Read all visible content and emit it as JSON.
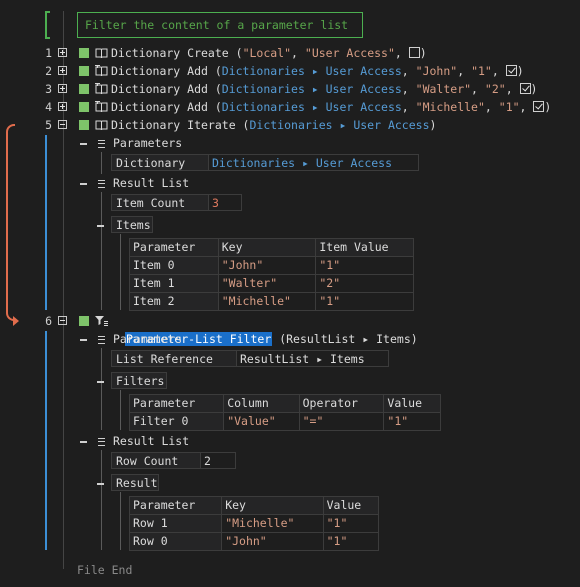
{
  "comment": "Filter the content of a parameter list",
  "lines": [
    {
      "num": "1",
      "parts": [
        [
          "Dictionary Create (",
          ""
        ],
        [
          "\"Local\"",
          "str"
        ],
        [
          ", ",
          ""
        ],
        [
          "\"User Access\"",
          "str"
        ],
        [
          ", ",
          ""
        ]
      ],
      "checked": false
    },
    {
      "num": "2",
      "parts": [
        [
          "Dictionary Add (",
          ""
        ],
        [
          "Dictionaries ▸ User Access",
          "acc"
        ],
        [
          ", ",
          ""
        ],
        [
          "\"John\"",
          "str"
        ],
        [
          ", ",
          ""
        ],
        [
          "\"1\"",
          "str"
        ],
        [
          ", ",
          ""
        ]
      ],
      "checked": true
    },
    {
      "num": "3",
      "parts": [
        [
          "Dictionary Add (",
          ""
        ],
        [
          "Dictionaries ▸ User Access",
          "acc"
        ],
        [
          ", ",
          ""
        ],
        [
          "\"Walter\"",
          "str"
        ],
        [
          ", ",
          ""
        ],
        [
          "\"2\"",
          "str"
        ],
        [
          ", ",
          ""
        ]
      ],
      "checked": true
    },
    {
      "num": "4",
      "parts": [
        [
          "Dictionary Add (",
          ""
        ],
        [
          "Dictionaries ▸ User Access",
          "acc"
        ],
        [
          ", ",
          ""
        ],
        [
          "\"Michelle\"",
          "str"
        ],
        [
          ", ",
          ""
        ],
        [
          "\"1\"",
          "str"
        ],
        [
          ", ",
          ""
        ]
      ],
      "checked": true
    },
    {
      "num": "5",
      "parts": [
        [
          "Dictionary Iterate (",
          ""
        ],
        [
          "Dictionaries ▸ User Access",
          "acc"
        ],
        [
          ")",
          ""
        ]
      ]
    }
  ],
  "close_paren": ")",
  "iterate": {
    "parameters_label": "Parameters",
    "dictionary_label": "Dictionary",
    "dictionary_value": "Dictionaries ▸ User Access",
    "result_list_label": "Result List",
    "item_count_label": "Item Count",
    "item_count_value": "3",
    "items_label": "Items",
    "table_headers": [
      "Parameter",
      "Key",
      "Item Value"
    ],
    "table_rows": [
      [
        "Item 0",
        "\"John\"",
        "\"1\""
      ],
      [
        "Item 1",
        "\"Walter\"",
        "\"2\""
      ],
      [
        "Item 2",
        "\"Michelle\"",
        "\"1\""
      ]
    ]
  },
  "filter": {
    "num": "6",
    "name": "Parameter-List Filter",
    "args": " (ResultList ▸ Items)",
    "parameters_label": "Parameters",
    "list_reference_label": "List Reference",
    "list_reference_value": "ResultList ▸ Items",
    "filters_label": "Filters",
    "filters_headers": [
      "Parameter",
      "Column",
      "Operator",
      "Value"
    ],
    "filters_rows": [
      [
        "Filter 0",
        "\"Value\"",
        "\"=\"",
        "\"1\""
      ]
    ],
    "result_list_label": "Result List",
    "row_count_label": "Row Count",
    "row_count_value": "2",
    "result_label": "Result",
    "result_headers": [
      "Parameter",
      "Key",
      "Value"
    ],
    "result_rows": [
      [
        "Row 1",
        "\"Michelle\"",
        "\"1\""
      ],
      [
        "Row 0",
        "\"John\"",
        "\"1\""
      ]
    ]
  },
  "file_end": "File End",
  "colors": {
    "accent": "#569cd6",
    "string": "#d69d85",
    "number": "#b5cea8",
    "green": "#7ec36a",
    "orange_arrow": "#e06c4c",
    "selection": "#1a6fc9"
  }
}
